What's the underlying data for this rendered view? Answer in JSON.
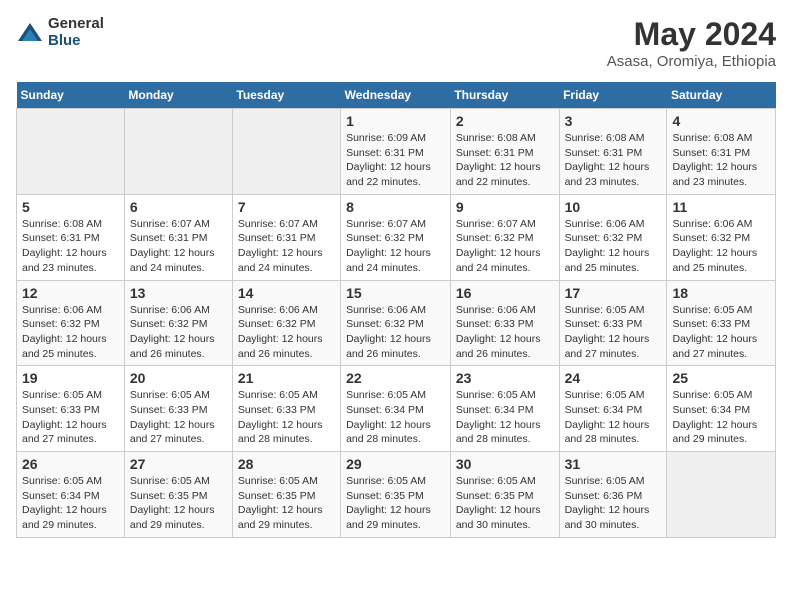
{
  "header": {
    "logo_general": "General",
    "logo_blue": "Blue",
    "title": "May 2024",
    "subtitle": "Asasa, Oromiya, Ethiopia"
  },
  "weekdays": [
    "Sunday",
    "Monday",
    "Tuesday",
    "Wednesday",
    "Thursday",
    "Friday",
    "Saturday"
  ],
  "weeks": [
    [
      {
        "day": "",
        "info": ""
      },
      {
        "day": "",
        "info": ""
      },
      {
        "day": "",
        "info": ""
      },
      {
        "day": "1",
        "info": "Sunrise: 6:09 AM\nSunset: 6:31 PM\nDaylight: 12 hours\nand 22 minutes."
      },
      {
        "day": "2",
        "info": "Sunrise: 6:08 AM\nSunset: 6:31 PM\nDaylight: 12 hours\nand 22 minutes."
      },
      {
        "day": "3",
        "info": "Sunrise: 6:08 AM\nSunset: 6:31 PM\nDaylight: 12 hours\nand 23 minutes."
      },
      {
        "day": "4",
        "info": "Sunrise: 6:08 AM\nSunset: 6:31 PM\nDaylight: 12 hours\nand 23 minutes."
      }
    ],
    [
      {
        "day": "5",
        "info": "Sunrise: 6:08 AM\nSunset: 6:31 PM\nDaylight: 12 hours\nand 23 minutes."
      },
      {
        "day": "6",
        "info": "Sunrise: 6:07 AM\nSunset: 6:31 PM\nDaylight: 12 hours\nand 24 minutes."
      },
      {
        "day": "7",
        "info": "Sunrise: 6:07 AM\nSunset: 6:31 PM\nDaylight: 12 hours\nand 24 minutes."
      },
      {
        "day": "8",
        "info": "Sunrise: 6:07 AM\nSunset: 6:32 PM\nDaylight: 12 hours\nand 24 minutes."
      },
      {
        "day": "9",
        "info": "Sunrise: 6:07 AM\nSunset: 6:32 PM\nDaylight: 12 hours\nand 24 minutes."
      },
      {
        "day": "10",
        "info": "Sunrise: 6:06 AM\nSunset: 6:32 PM\nDaylight: 12 hours\nand 25 minutes."
      },
      {
        "day": "11",
        "info": "Sunrise: 6:06 AM\nSunset: 6:32 PM\nDaylight: 12 hours\nand 25 minutes."
      }
    ],
    [
      {
        "day": "12",
        "info": "Sunrise: 6:06 AM\nSunset: 6:32 PM\nDaylight: 12 hours\nand 25 minutes."
      },
      {
        "day": "13",
        "info": "Sunrise: 6:06 AM\nSunset: 6:32 PM\nDaylight: 12 hours\nand 26 minutes."
      },
      {
        "day": "14",
        "info": "Sunrise: 6:06 AM\nSunset: 6:32 PM\nDaylight: 12 hours\nand 26 minutes."
      },
      {
        "day": "15",
        "info": "Sunrise: 6:06 AM\nSunset: 6:32 PM\nDaylight: 12 hours\nand 26 minutes."
      },
      {
        "day": "16",
        "info": "Sunrise: 6:06 AM\nSunset: 6:33 PM\nDaylight: 12 hours\nand 26 minutes."
      },
      {
        "day": "17",
        "info": "Sunrise: 6:05 AM\nSunset: 6:33 PM\nDaylight: 12 hours\nand 27 minutes."
      },
      {
        "day": "18",
        "info": "Sunrise: 6:05 AM\nSunset: 6:33 PM\nDaylight: 12 hours\nand 27 minutes."
      }
    ],
    [
      {
        "day": "19",
        "info": "Sunrise: 6:05 AM\nSunset: 6:33 PM\nDaylight: 12 hours\nand 27 minutes."
      },
      {
        "day": "20",
        "info": "Sunrise: 6:05 AM\nSunset: 6:33 PM\nDaylight: 12 hours\nand 27 minutes."
      },
      {
        "day": "21",
        "info": "Sunrise: 6:05 AM\nSunset: 6:33 PM\nDaylight: 12 hours\nand 28 minutes."
      },
      {
        "day": "22",
        "info": "Sunrise: 6:05 AM\nSunset: 6:34 PM\nDaylight: 12 hours\nand 28 minutes."
      },
      {
        "day": "23",
        "info": "Sunrise: 6:05 AM\nSunset: 6:34 PM\nDaylight: 12 hours\nand 28 minutes."
      },
      {
        "day": "24",
        "info": "Sunrise: 6:05 AM\nSunset: 6:34 PM\nDaylight: 12 hours\nand 28 minutes."
      },
      {
        "day": "25",
        "info": "Sunrise: 6:05 AM\nSunset: 6:34 PM\nDaylight: 12 hours\nand 29 minutes."
      }
    ],
    [
      {
        "day": "26",
        "info": "Sunrise: 6:05 AM\nSunset: 6:34 PM\nDaylight: 12 hours\nand 29 minutes."
      },
      {
        "day": "27",
        "info": "Sunrise: 6:05 AM\nSunset: 6:35 PM\nDaylight: 12 hours\nand 29 minutes."
      },
      {
        "day": "28",
        "info": "Sunrise: 6:05 AM\nSunset: 6:35 PM\nDaylight: 12 hours\nand 29 minutes."
      },
      {
        "day": "29",
        "info": "Sunrise: 6:05 AM\nSunset: 6:35 PM\nDaylight: 12 hours\nand 29 minutes."
      },
      {
        "day": "30",
        "info": "Sunrise: 6:05 AM\nSunset: 6:35 PM\nDaylight: 12 hours\nand 30 minutes."
      },
      {
        "day": "31",
        "info": "Sunrise: 6:05 AM\nSunset: 6:36 PM\nDaylight: 12 hours\nand 30 minutes."
      },
      {
        "day": "",
        "info": ""
      }
    ]
  ]
}
